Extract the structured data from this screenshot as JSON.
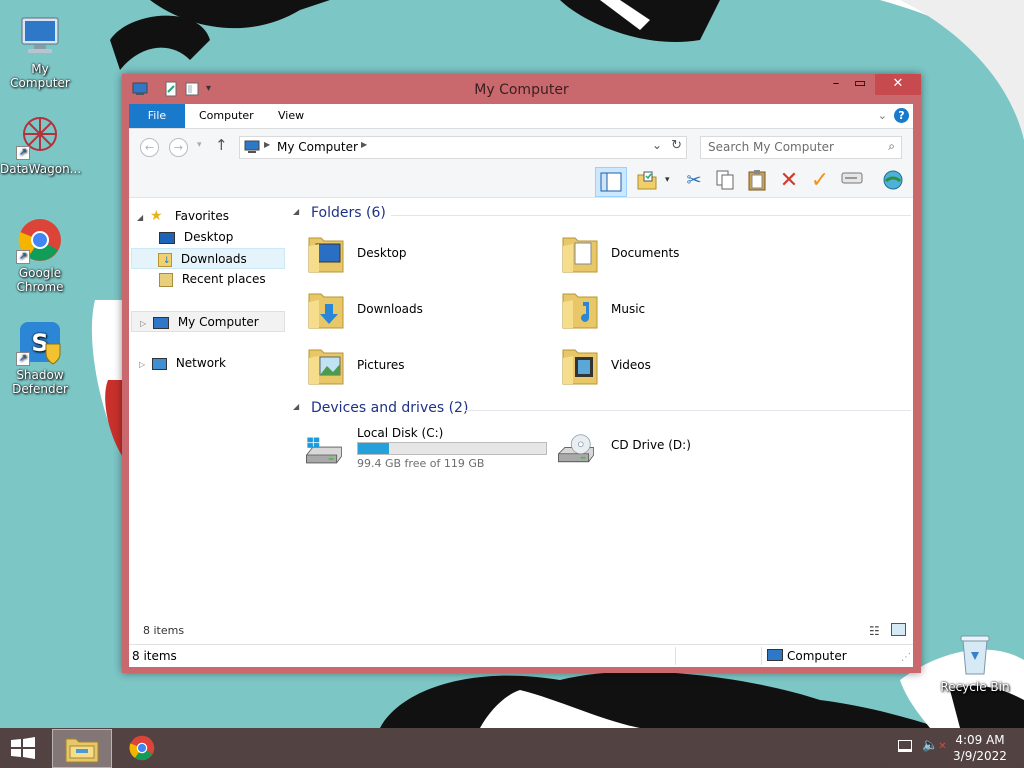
{
  "desktop": {
    "icons": [
      {
        "label": "My Computer"
      },
      {
        "label": "DataWagon..."
      },
      {
        "label": "Google Chrome"
      },
      {
        "label": "Shadow Defender"
      },
      {
        "label": "Recycle Bin"
      }
    ]
  },
  "window": {
    "title": "My Computer",
    "ribbon_tabs": [
      "File",
      "Computer",
      "View"
    ],
    "address": {
      "segment": "My Computer"
    },
    "search": {
      "placeholder": "Search My Computer"
    },
    "navpane": {
      "favorites": "Favorites",
      "favorites_items": [
        "Desktop",
        "Downloads",
        "Recent places"
      ],
      "my_computer": "My Computer",
      "network": "Network"
    },
    "groups": {
      "folders_title": "Folders (6)",
      "folders": [
        "Desktop",
        "Documents",
        "Downloads",
        "Music",
        "Pictures",
        "Videos"
      ],
      "devices_title": "Devices and drives (2)",
      "drives": [
        {
          "name": "Local Disk (C:)",
          "free_text": "99.4 GB free of 119 GB",
          "used_fraction": 0.165
        },
        {
          "name": "CD Drive (D:)"
        }
      ]
    },
    "inner_status": "8 items",
    "status": {
      "items": "8 items",
      "location": "Computer"
    }
  },
  "taskbar": {
    "time": "4:09 AM",
    "date": "3/9/2022"
  },
  "colors": {
    "accent": "#1979ca",
    "window_frame": "#c9696d",
    "close_button": "#c74a4f",
    "wallpaper": "#7cc6c6",
    "drive_fill": "#26a0da",
    "group_heading": "#1e3287",
    "selection": "#cce8ff"
  }
}
